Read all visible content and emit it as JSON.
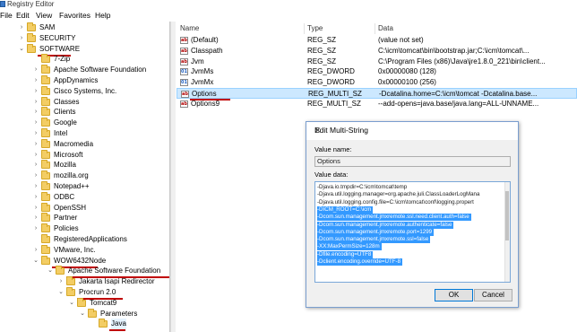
{
  "window": {
    "title": "Registry Editor"
  },
  "menu": [
    "File",
    "Edit",
    "View",
    "Favorites",
    "Help"
  ],
  "tree": [
    {
      "label": "SAM",
      "arrow": "›",
      "indent": 0
    },
    {
      "label": "SECURITY",
      "arrow": "›",
      "indent": 0
    },
    {
      "label": "SOFTWARE",
      "arrow": "⌄",
      "indent": 0,
      "underline": true
    },
    {
      "label": "7-Zip",
      "arrow": "",
      "indent": 1
    },
    {
      "label": "Apache Software Foundation",
      "arrow": "›",
      "indent": 1
    },
    {
      "label": "AppDynamics",
      "arrow": "›",
      "indent": 1
    },
    {
      "label": "Cisco Systems, Inc.",
      "arrow": "›",
      "indent": 1
    },
    {
      "label": "Classes",
      "arrow": "›",
      "indent": 1
    },
    {
      "label": "Clients",
      "arrow": "›",
      "indent": 1
    },
    {
      "label": "Google",
      "arrow": "›",
      "indent": 1
    },
    {
      "label": "Intel",
      "arrow": "›",
      "indent": 1
    },
    {
      "label": "Macromedia",
      "arrow": "›",
      "indent": 1
    },
    {
      "label": "Microsoft",
      "arrow": "›",
      "indent": 1
    },
    {
      "label": "Mozilla",
      "arrow": "›",
      "indent": 1
    },
    {
      "label": "mozilla.org",
      "arrow": "›",
      "indent": 1
    },
    {
      "label": "Notepad++",
      "arrow": "›",
      "indent": 1
    },
    {
      "label": "ODBC",
      "arrow": "›",
      "indent": 1
    },
    {
      "label": "OpenSSH",
      "arrow": "›",
      "indent": 1
    },
    {
      "label": "Partner",
      "arrow": "›",
      "indent": 1
    },
    {
      "label": "Policies",
      "arrow": "›",
      "indent": 1
    },
    {
      "label": "RegisteredApplications",
      "arrow": "",
      "indent": 1
    },
    {
      "label": "VMware, Inc.",
      "arrow": "›",
      "indent": 1
    },
    {
      "label": "WOW6432Node",
      "arrow": "⌄",
      "indent": 1,
      "underline": true
    },
    {
      "label": "Apache Software Foundation",
      "arrow": "⌄",
      "indent": 2,
      "underline": true
    },
    {
      "label": "Jakarta Isapi Redirector",
      "arrow": "›",
      "indent": 3
    },
    {
      "label": "Procrun 2.0",
      "arrow": "⌄",
      "indent": 3,
      "underline": true
    },
    {
      "label": "Tomcat9",
      "arrow": "⌄",
      "indent": 4
    },
    {
      "label": "Parameters",
      "arrow": "⌄",
      "indent": 5
    },
    {
      "label": "Java",
      "arrow": "",
      "indent": 6,
      "underline": true,
      "selected": true
    }
  ],
  "list": {
    "headers": {
      "name": "Name",
      "type": "Type",
      "data": "Data"
    },
    "rows": [
      {
        "icon": "ab",
        "name": "(Default)",
        "type": "REG_SZ",
        "data": "(value not set)"
      },
      {
        "icon": "ab",
        "name": "Classpath",
        "type": "REG_SZ",
        "data": "C:\\icm\\tomcat\\bin\\bootstrap.jar;C:\\icm\\tomcat\\..."
      },
      {
        "icon": "ab",
        "name": "Jvm",
        "type": "REG_SZ",
        "data": "C:\\Program Files (x86)\\Java\\jre1.8.0_221\\bin\\client..."
      },
      {
        "icon": "bin",
        "name": "JvmMs",
        "type": "REG_DWORD",
        "data": "0x00000080 (128)"
      },
      {
        "icon": "bin",
        "name": "JvmMx",
        "type": "REG_DWORD",
        "data": "0x00000100 (256)"
      },
      {
        "icon": "ab",
        "name": "Options",
        "type": "REG_MULTI_SZ",
        "data": "-Dcatalina.home=C:\\icm\\tomcat -Dcatalina.base...",
        "selected": true
      },
      {
        "icon": "ab",
        "name": "Options9",
        "type": "REG_MULTI_SZ",
        "data": "--add-opens=java.base/java.lang=ALL-UNNAME..."
      }
    ]
  },
  "dialog": {
    "title": "Edit Multi-String",
    "close": "✕",
    "value_name_label": "Value name:",
    "value_name": "Options",
    "value_data_label": "Value data:",
    "lines": [
      {
        "text": "-Djava.io.tmpdir=C:\\icm\\tomcat\\temp",
        "hl": false
      },
      {
        "text": "-Djava.util.logging.manager=org.apache.juli.ClassLoaderLogMana",
        "hl": false
      },
      {
        "text": "-Djava.util.logging.config.file=C:\\icm\\tomcat\\conf\\logging.propert",
        "hl": false
      },
      {
        "text": "-DICM_ROOT=C:\\icm",
        "hl": true
      },
      {
        "text": "-Dcom.sun.management.jmxremote.ssl.need.client.auth=false",
        "hl": true
      },
      {
        "text": "-Dcom.sun.management.jmxremote.authenticate=false",
        "hl": true
      },
      {
        "text": "-Dcom.sun.management.jmxremote.port=1299",
        "hl": true
      },
      {
        "text": "-Dcom.sun.management.jmxremote.ssl=false",
        "hl": true
      },
      {
        "text": "-XX:MaxPermSize=128m",
        "hl": true
      },
      {
        "text": "-Dfile.encoding=UTF8",
        "hl": true
      },
      {
        "text": "-Dclient.encoding.override=UTF-8",
        "hl": true
      }
    ],
    "ok": "OK",
    "cancel": "Cancel"
  }
}
